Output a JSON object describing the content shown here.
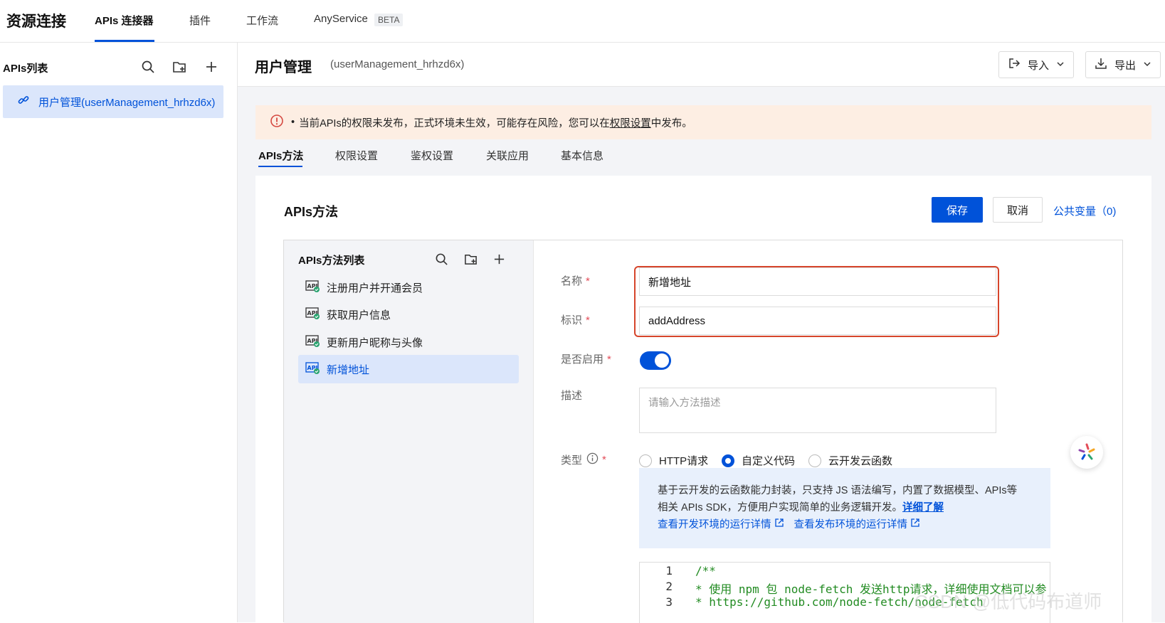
{
  "topnav": {
    "brand": "资源连接",
    "tabs": [
      {
        "label": "APIs 连接器"
      },
      {
        "label": "插件"
      },
      {
        "label": "工作流"
      },
      {
        "label": "AnyService"
      }
    ],
    "beta": "BETA"
  },
  "sidebar": {
    "title": "APIs列表",
    "items": [
      {
        "label": "用户管理(userManagement_hrhzd6x)"
      }
    ]
  },
  "header": {
    "title": "用户管理",
    "subtitle": "(userManagement_hrhzd6x)",
    "import_label": "导入",
    "export_label": "导出"
  },
  "alert": {
    "text_before": "当前APIs的权限未发布，正式环境未生效，可能存在风险，您可以在",
    "link": "权限设置",
    "text_after": "中发布。"
  },
  "tabs": [
    {
      "label": "APIs方法"
    },
    {
      "label": "权限设置"
    },
    {
      "label": "鉴权设置"
    },
    {
      "label": "关联应用"
    },
    {
      "label": "基本信息"
    }
  ],
  "card": {
    "title": "APIs方法",
    "save_label": "保存",
    "cancel_label": "取消",
    "public_vars": "公共变量（0)"
  },
  "methods": {
    "title": "APIs方法列表",
    "items": [
      {
        "label": "注册用户并开通会员"
      },
      {
        "label": "获取用户信息"
      },
      {
        "label": "更新用户昵称与头像"
      },
      {
        "label": "新增地址"
      }
    ]
  },
  "form": {
    "name_label": "名称",
    "name_value": "新增地址",
    "id_label": "标识",
    "id_value": "addAddress",
    "enabled_label": "是否启用",
    "enabled": true,
    "desc_label": "描述",
    "desc_placeholder": "请输入方法描述",
    "type_label": "类型",
    "type_options": [
      {
        "label": "HTTP请求",
        "selected": false
      },
      {
        "label": "自定义代码",
        "selected": true
      },
      {
        "label": "云开发云函数",
        "selected": false
      }
    ],
    "info_line1": "基于云开发的云函数能力封装，只支持 JS 语法编写，内置了数据模型、APIs等",
    "info_line2": "相关 APIs SDK，方便用户实现简单的业务逻辑开发。",
    "info_link": "详细了解",
    "dev_link": "查看开发环境的运行详情",
    "prod_link": "查看发布环境的运行详情"
  },
  "code": [
    {
      "num": "1",
      "text": "/**"
    },
    {
      "num": "2",
      "text": "* 使用 npm 包 node-fetch 发送http请求，详细使用文档可以参"
    },
    {
      "num": "3",
      "text": "*  https://github.com/node-fetch/node-fetch"
    }
  ],
  "watermark": "CSDN @低代码布道师",
  "colors": {
    "primary": "#0052d9",
    "alert_bg": "#fdeee3",
    "required": "#e34d59",
    "highlight_box": "#d6452b"
  }
}
